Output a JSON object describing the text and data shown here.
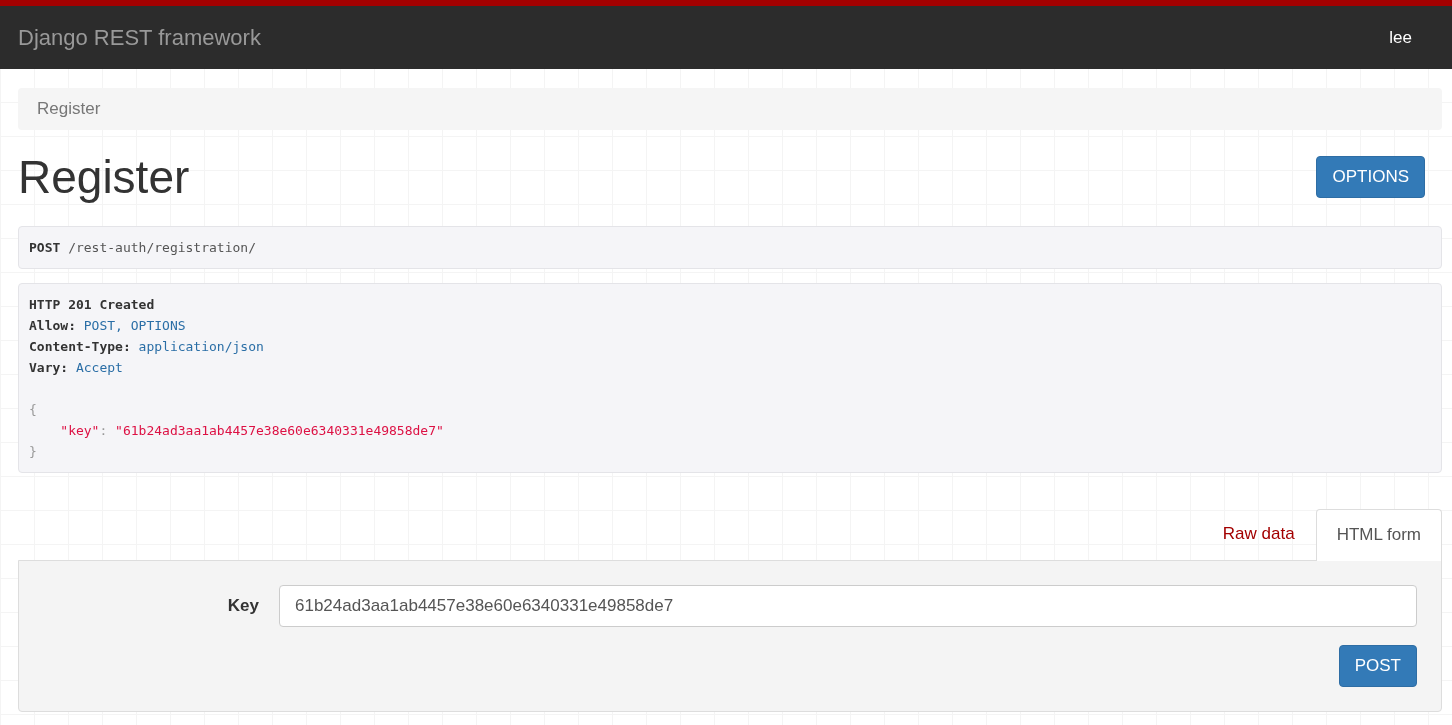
{
  "navbar": {
    "brand": "Django REST framework",
    "user": "lee"
  },
  "breadcrumb": [
    "Register"
  ],
  "page": {
    "title": "Register",
    "options_button": "OPTIONS"
  },
  "request": {
    "method": "POST",
    "path": "/rest-auth/registration/"
  },
  "response": {
    "status": "HTTP 201 Created",
    "headers": [
      {
        "name": "Allow:",
        "value": "POST, OPTIONS"
      },
      {
        "name": "Content-Type:",
        "value": "application/json"
      },
      {
        "name": "Vary:",
        "value": "Accept"
      }
    ],
    "body": [
      {
        "kind": "brace",
        "text": "{"
      },
      {
        "kind": "pair",
        "key": "\"key\"",
        "sep": ":",
        "value": "\"61b24ad3aa1ab4457e38e60e6340331e49858de7\""
      },
      {
        "kind": "brace",
        "text": "}"
      }
    ]
  },
  "tabs": [
    {
      "label": "Raw data",
      "selected": false
    },
    {
      "label": "HTML form",
      "selected": true
    }
  ],
  "form": {
    "fields": [
      {
        "label": "Key",
        "value": "61b24ad3aa1ab4457e38e60e6340331e49858de7"
      }
    ],
    "submit": "POST"
  }
}
